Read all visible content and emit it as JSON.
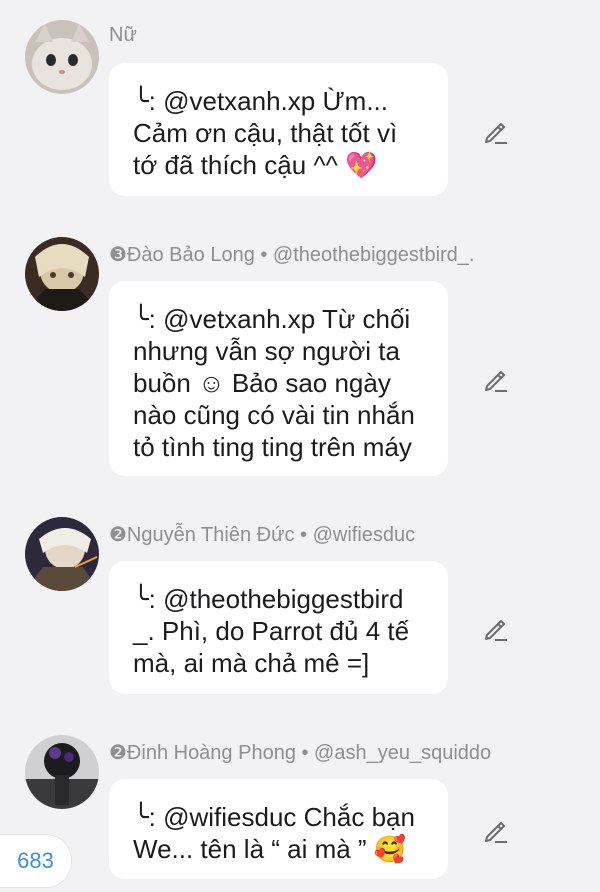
{
  "messages": [
    {
      "author": "Nữ",
      "lines": [
        "╰: @vetxanh.xp Ừm...",
        "Cảm ơn cậu, thật tốt vì",
        "tớ đã thích cậu ^^ 💖"
      ],
      "avatar_icon": "cat-avatar"
    },
    {
      "author": "❸Đào Bảo Long • @theothebiggestbird_.",
      "lines": [
        "╰: @vetxanh.xp Từ chối",
        "nhưng vẫn sợ người ta",
        "buồn ☺ Bảo sao ngày",
        "nào cũng có vài tin nhắn",
        "tỏ tình ting ting trên máy"
      ],
      "avatar_icon": "anime-avatar"
    },
    {
      "author": "❷Nguyễn Thiên Đức • @wifiesduc",
      "lines": [
        "╰: @theothebiggestbird",
        "_. Phì, do Parrot đủ 4 tế",
        "mà, ai mà chả mê =]"
      ],
      "avatar_icon": "anime-avatar"
    },
    {
      "author": "❷Đinh Hoàng Phong • @ash_yeu_squiddo",
      "lines": [
        "╰: @wifiesduc Chắc bạn",
        "We... tên là “ ai mà ” 🥰"
      ],
      "avatar_icon": "dark-avatar"
    }
  ],
  "counter": "683",
  "colors": {
    "background": "#f2f2f4",
    "bubble": "#ffffff",
    "meta": "#8e8e93",
    "counter": "#3d8fd8"
  }
}
